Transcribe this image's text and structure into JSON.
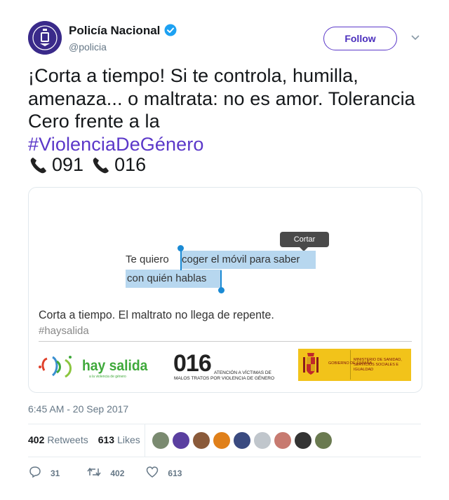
{
  "author": {
    "name": "Policía Nacional",
    "handle": "@policia",
    "verified": true
  },
  "follow_label": "Follow",
  "tweet": {
    "text_plain": "¡Corta a tiempo! Si te controla, humilla, amenaza... o maltrata: no es amor. Tolerancia Cero frente a la",
    "hashtag": "#ViolenciaDeGénero",
    "phone_1": "091",
    "phone_2": "016"
  },
  "media": {
    "tooltip": "Cortar",
    "demo_plain": "Te quiero",
    "demo_selected_1": "coger el móvil para saber",
    "demo_selected_2": "con quién hablas",
    "caption": "Corta a tiempo. El maltrato no llega de repente.",
    "caption_tag": "#haysalida",
    "logo_hay_salida": "hay salida",
    "logo_hay_salida_sub": "a la violencia de género",
    "logo_016": "016",
    "logo_016_desc_1": "ATENCIÓN A VÍCTIMAS DE",
    "logo_016_desc_2": "MALOS TRATOS POR VIOLENCIA DE GÉNERO",
    "gov_1": "GOBIERNO DE ESPAÑA",
    "gov_2": "MINISTERIO DE SANIDAD, SERVICIOS SOCIALES E IGUALDAD"
  },
  "timestamp": "6:45 AM - 20 Sep 2017",
  "stats": {
    "retweets_count": "402",
    "retweets_label": "Retweets",
    "likes_count": "613",
    "likes_label": "Likes"
  },
  "liker_avatar_colors": [
    "#7a8a70",
    "#5a3fa0",
    "#8a5a3a",
    "#e0801a",
    "#3a4a80",
    "#c0c6cc",
    "#c77a70",
    "#333333",
    "#6a7a50"
  ],
  "actions": {
    "reply_count": "31",
    "retweet_count": "402",
    "like_count": "613"
  },
  "colors": {
    "accent": "#5b38c9",
    "verified": "#1da1f2",
    "muted": "#657786"
  }
}
